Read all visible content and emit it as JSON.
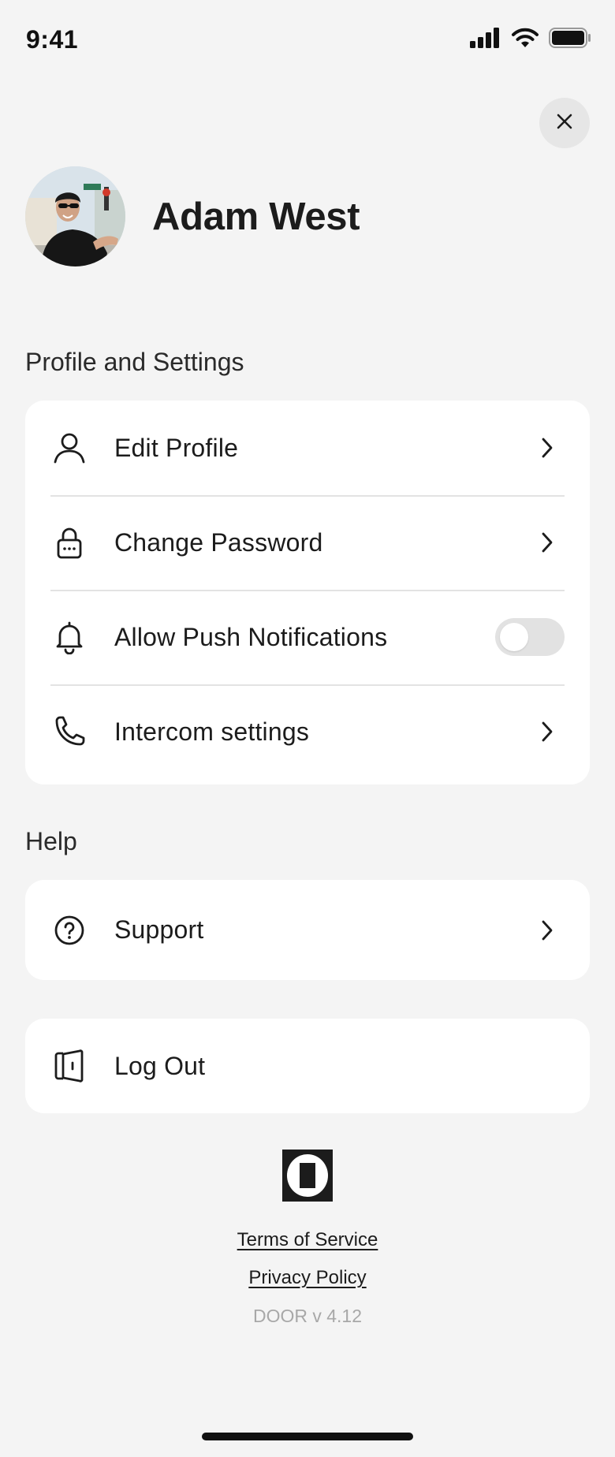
{
  "status_bar": {
    "time": "9:41",
    "icons": [
      "cellular-signal-icon",
      "wifi-icon",
      "battery-icon"
    ]
  },
  "header": {
    "close_icon": "close-icon",
    "user_name": "Adam West"
  },
  "sections": {
    "profile_settings": {
      "title": "Profile and Settings",
      "items": [
        {
          "label": "Edit Profile",
          "icon": "user-icon",
          "control": "chevron"
        },
        {
          "label": "Change Password",
          "icon": "lock-icon",
          "control": "chevron"
        },
        {
          "label": "Allow Push Notifications",
          "icon": "bell-icon",
          "control": "toggle",
          "toggle_on": false
        },
        {
          "label": "Intercom settings",
          "icon": "phone-icon",
          "control": "chevron"
        }
      ]
    },
    "help": {
      "title": "Help",
      "items": [
        {
          "label": "Support",
          "icon": "help-circle-icon",
          "control": "chevron"
        }
      ]
    },
    "logout": {
      "label": "Log Out",
      "icon": "door-exit-icon"
    }
  },
  "footer": {
    "terms": "Terms of Service",
    "privacy": "Privacy Policy",
    "version": "DOOR v 4.12"
  },
  "colors": {
    "background": "#f4f4f4",
    "card": "#ffffff",
    "text": "#1c1c1c",
    "muted": "#a8a8a8",
    "toggle_off": "#e2e2e2"
  }
}
